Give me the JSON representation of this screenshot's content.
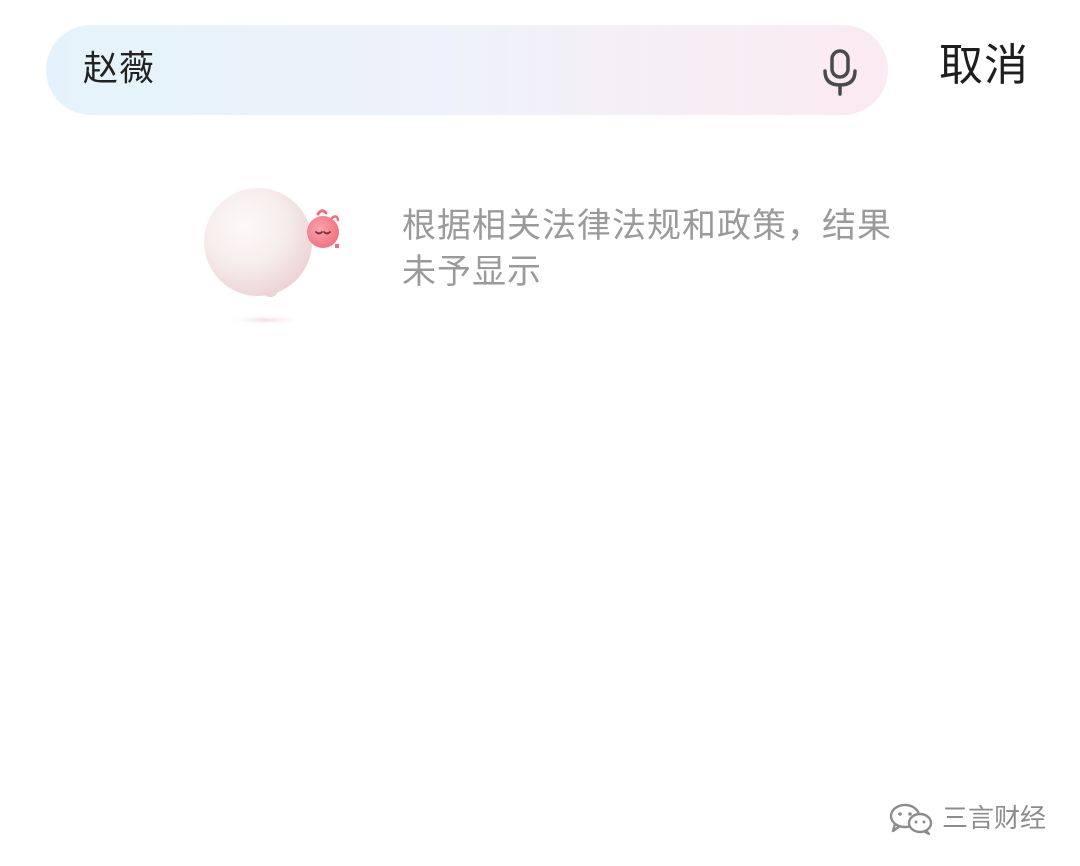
{
  "search": {
    "query": "赵薇",
    "cancel_label": "取消",
    "icon": "microphone-icon"
  },
  "result": {
    "notice": "根据相关法律法规和政策，结果未予显示",
    "illustration": "empty-result-balloon-illustration"
  },
  "watermark": {
    "text": "三言财经",
    "icon": "wechat-icon"
  },
  "colors": {
    "search_bar_start": "#e4f3fb",
    "search_bar_end": "#fbeaf1",
    "notice_text": "#9a9a9a",
    "balloon_accent": "#f07a86"
  }
}
